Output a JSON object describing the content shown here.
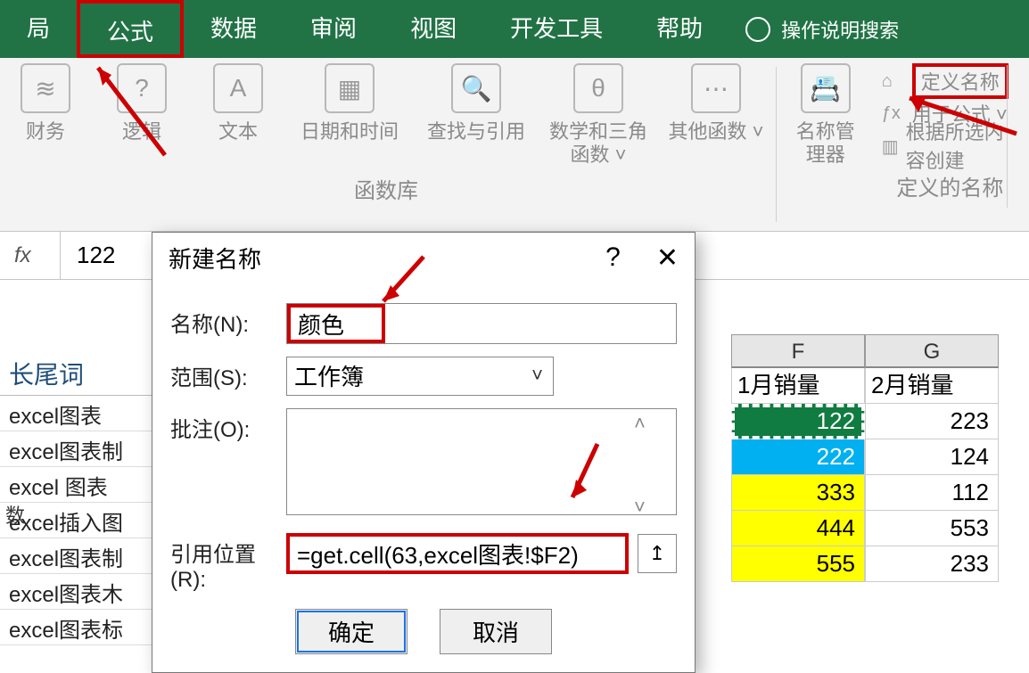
{
  "ribbon": {
    "tabs": [
      "局",
      "公式",
      "数据",
      "审阅",
      "视图",
      "开发工具",
      "帮助"
    ],
    "tell_me": "操作说明搜索",
    "buttons": {
      "finance": "财务",
      "logic": "逻辑",
      "text": "文本",
      "datetime": "日期和时间",
      "lookup": "查找与引用",
      "math": "数学和三角函数 ˅",
      "more": "其他函数 ˅",
      "namemgr": "名称管理器"
    },
    "group_funclib": "函数库",
    "defnames": {
      "define": "定义名称",
      "usein": "用于公式 ˅",
      "create": "根据所选内容创建",
      "group": "定义的名称"
    }
  },
  "formula_bar": {
    "value": "122"
  },
  "left_column": {
    "header": "长尾词",
    "rows": [
      "excel图表",
      "excel图表制",
      "excel 图表",
      "excel插入图",
      "excel图表制",
      "excel图表木",
      "excel图表标"
    ],
    "row_label": "数"
  },
  "right_grid": {
    "cols": [
      "F",
      "G"
    ],
    "headers": [
      "1月销量",
      "2月销量"
    ],
    "data": [
      {
        "f": "122",
        "g": "223",
        "fill": "sel"
      },
      {
        "f": "222",
        "g": "124",
        "fill": "blue"
      },
      {
        "f": "333",
        "g": "112",
        "fill": "yellow"
      },
      {
        "f": "444",
        "g": "553",
        "fill": "yellow"
      },
      {
        "f": "555",
        "g": "233",
        "fill": "yellow"
      }
    ]
  },
  "dialog": {
    "title": "新建名称",
    "labels": {
      "name": "名称(N):",
      "scope": "范围(S):",
      "comment": "批注(O):",
      "refersto": "引用位置(R):"
    },
    "name_value": "颜色",
    "scope_value": "工作簿",
    "comment_value": "",
    "refersto_value": "=get.cell(63,excel图表!$F2)",
    "ok": "确定",
    "cancel": "取消"
  },
  "chart_data": null
}
